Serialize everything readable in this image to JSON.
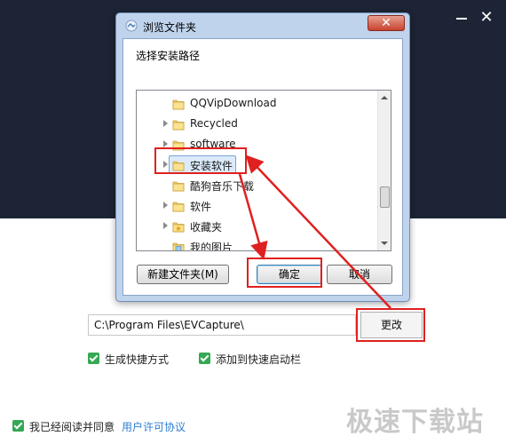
{
  "dialog": {
    "title": "浏览文件夹",
    "close_label": "✕",
    "description": "选择安装路径",
    "tree": [
      {
        "label": "QQVipDownload",
        "expander": false,
        "folder": "folder",
        "selected": false
      },
      {
        "label": "Recycled",
        "expander": true,
        "folder": "folder",
        "selected": false
      },
      {
        "label": "software",
        "expander": true,
        "folder": "folder",
        "selected": false
      },
      {
        "label": "安装软件",
        "expander": true,
        "folder": "folder",
        "selected": true
      },
      {
        "label": "酷狗音乐下载",
        "expander": false,
        "folder": "folder",
        "selected": false
      },
      {
        "label": "软件",
        "expander": true,
        "folder": "folder",
        "selected": false
      },
      {
        "label": "收藏夹",
        "expander": true,
        "folder": "star-folder",
        "selected": false
      },
      {
        "label": "我的图片",
        "expander": false,
        "folder": "picture-folder",
        "selected": false
      }
    ],
    "buttons": {
      "new_folder": "新建文件夹(M)",
      "ok": "确定",
      "cancel": "取消"
    }
  },
  "installer": {
    "path_value": "C:\\Program Files\\EVCapture\\",
    "change_label": "更改",
    "shortcut_label": "生成快捷方式",
    "quicklaunch_label": "添加到快速启动栏",
    "agree_label": "我已经阅读并同意",
    "license_link": "用户许可协议",
    "minimize_label": "—",
    "close_label": "✕"
  },
  "watermark": "极速下载站",
  "colors": {
    "header_bg": "#1c2435",
    "annotation_red": "#e02020",
    "checkbox_green": "#35a853",
    "link_blue": "#2d7dd2"
  }
}
